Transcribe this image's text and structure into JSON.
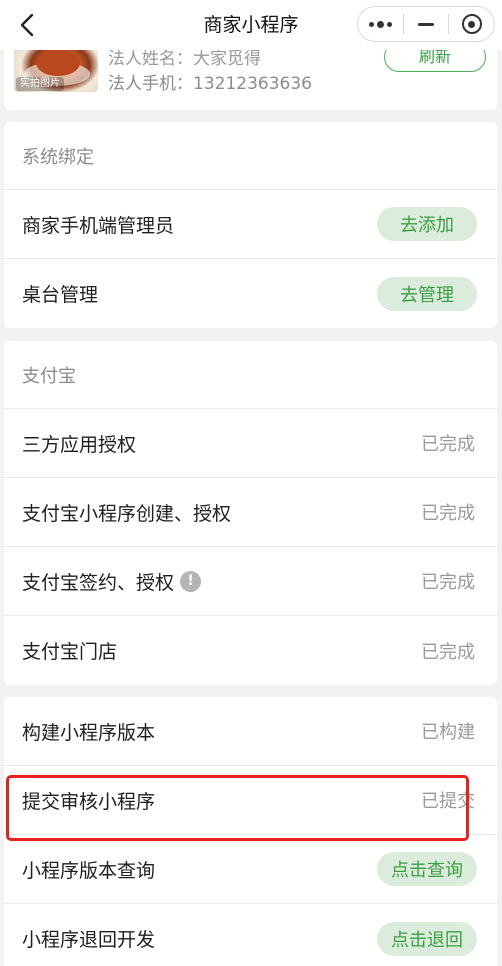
{
  "nav": {
    "title": "商家小程序",
    "back_icon": "chevron-left-icon",
    "more_icon": "more-dots-icon",
    "minimize_icon": "minimize-icon",
    "close_icon": "target-circle-icon"
  },
  "profile": {
    "image_tag": "实拍图片",
    "legal_name_label": "法人姓名：大家觅得",
    "legal_phone_label": "法人手机：13212363636",
    "refresh_label": "刷新"
  },
  "system_binding": {
    "title": "系统绑定",
    "items": [
      {
        "label": "商家手机端管理员",
        "action": "去添加"
      },
      {
        "label": "桌台管理",
        "action": "去管理"
      }
    ]
  },
  "alipay": {
    "title": "支付宝",
    "items": [
      {
        "label": "三方应用授权",
        "status": "已完成"
      },
      {
        "label": "支付宝小程序创建、授权",
        "status": "已完成"
      },
      {
        "label": "支付宝签约、授权",
        "status": "已完成",
        "info_icon": "!"
      },
      {
        "label": "支付宝门店",
        "status": "已完成"
      }
    ]
  },
  "mini_program": {
    "items": [
      {
        "label": "构建小程序版本",
        "status": "已构建"
      },
      {
        "label": "提交审核小程序",
        "status": "已提交"
      },
      {
        "label": "小程序版本查询",
        "action": "点击查询"
      },
      {
        "label": "小程序退回开发",
        "action": "点击退回"
      }
    ]
  },
  "colors": {
    "accent_green": "#3aa041",
    "pill_bg": "#dcecdc",
    "highlight_red": "#e8231d"
  }
}
